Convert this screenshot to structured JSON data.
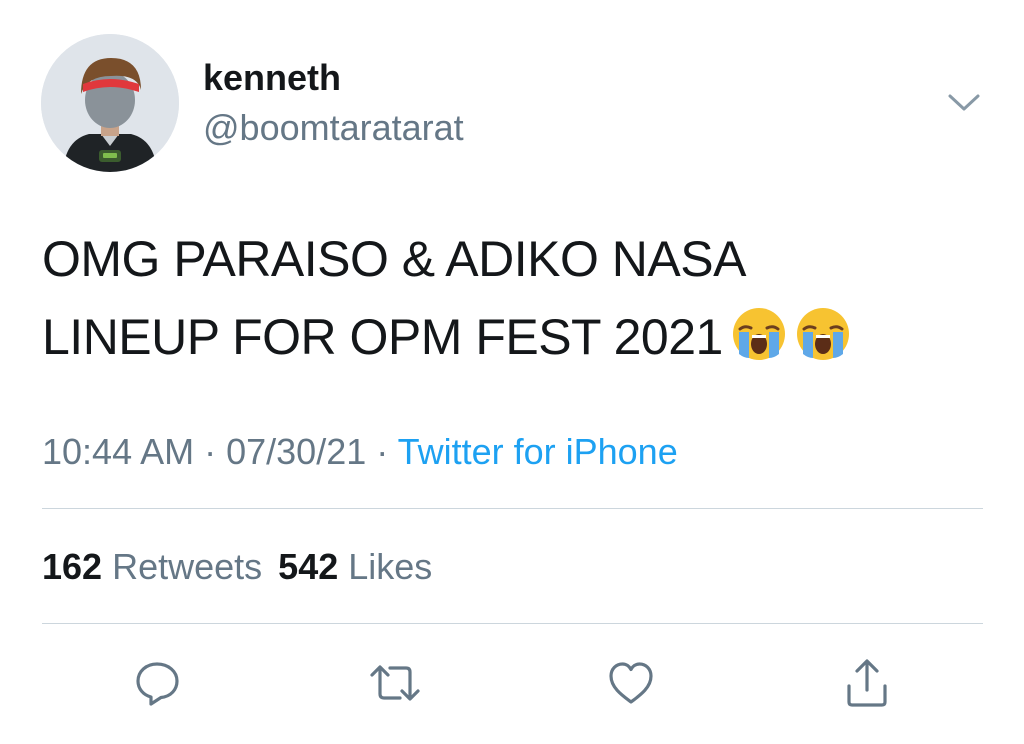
{
  "user": {
    "display_name": "kenneth",
    "handle": "@boomtaratarat",
    "avatar_icon": "profile-avatar"
  },
  "tweet": {
    "lines": [
      "OMG PARAISO & ADIKO NASA",
      "LINEUP FOR OPM FEST 2021"
    ],
    "emojis": [
      "loudly-crying-face",
      "loudly-crying-face"
    ]
  },
  "meta": {
    "time": "10:44 AM",
    "sep1": " · ",
    "date": "07/30/21",
    "sep2": " · ",
    "source": "Twitter for iPhone"
  },
  "stats": {
    "retweets_count": "162",
    "retweets_label": "Retweets",
    "likes_count": "542",
    "likes_label": "Likes"
  },
  "actions": [
    "reply-icon",
    "retweet-icon",
    "like-icon",
    "share-icon"
  ],
  "colors": {
    "text": "#14171a",
    "secondary": "#657786",
    "link": "#1da1f2",
    "divider": "#ccd6dd"
  }
}
